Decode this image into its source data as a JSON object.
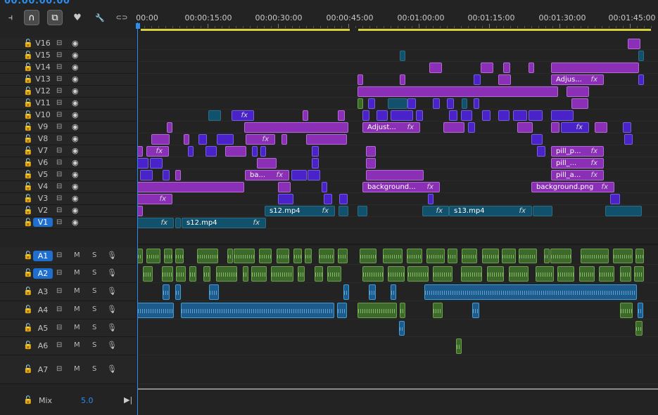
{
  "timecode": "00:00:00:00",
  "toolbar": {
    "tools": [
      {
        "name": "insert-tool-icon",
        "glyph": "⫞"
      },
      {
        "name": "snap-magnet-icon",
        "glyph": "∩"
      },
      {
        "name": "linked-selection-icon",
        "glyph": "⧉"
      },
      {
        "name": "add-marker-icon",
        "glyph": "♥"
      },
      {
        "name": "wrench-settings-icon",
        "glyph": "🔧"
      },
      {
        "name": "captions-icon",
        "glyph": "⊂⊃"
      }
    ]
  },
  "ruler": {
    "labels": [
      "00:00",
      "00:00:15:00",
      "00:00:30:00",
      "00:00:45:00",
      "00:01:00:00",
      "00:01:15:00",
      "00:01:30:00",
      "00:01:45:00"
    ]
  },
  "video_tracks": [
    "V16",
    "V15",
    "V14",
    "V13",
    "V12",
    "V11",
    "V10",
    "V9",
    "V8",
    "V7",
    "V6",
    "V5",
    "V4",
    "V3",
    "V2",
    "V1"
  ],
  "audio_tracks": [
    "A1",
    "A2",
    "A3",
    "A4",
    "A5",
    "A6",
    "A7"
  ],
  "targeted_tracks": [
    "V1",
    "A1",
    "A2"
  ],
  "audio_buttons": {
    "mute": "M",
    "solo": "S"
  },
  "clip_labels": {
    "adjust_1": "Adjus...",
    "adjust_2": "Adjust...",
    "ba": "ba...",
    "pill_p": "pill_p...",
    "pill_dots": "pill_...",
    "pill_a": "pill_a...",
    "background_1": "background...",
    "background_2": "background.png",
    "s12": "s12.mp4",
    "s12_v1": "s12.mp4",
    "s13": "s13.mp4",
    "fx": "fx"
  },
  "mix": {
    "label": "Mix",
    "value": "5.0"
  }
}
